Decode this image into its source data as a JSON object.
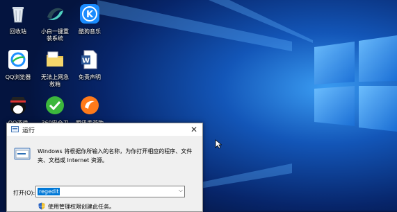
{
  "desktop": {
    "icons": [
      {
        "label": "回收站",
        "icon": "recycle-bin-icon"
      },
      {
        "label": "小白一键重装系统",
        "icon": "xiaobai-reinstall-icon"
      },
      {
        "label": "酷狗音乐",
        "icon": "kugou-music-icon"
      },
      {
        "label": "QQ浏览器",
        "icon": "qq-browser-icon"
      },
      {
        "label": "无法上网急救箱",
        "icon": "folder-icon"
      },
      {
        "label": "免责声明",
        "icon": "word-document-icon"
      },
      {
        "label": "QQ游戏",
        "icon": "qq-game-icon"
      },
      {
        "label": "360安全卫士",
        "icon": "360-safe-icon"
      },
      {
        "label": "腾讯手游助手",
        "icon": "tencent-mobile-game-icon"
      }
    ]
  },
  "run_dialog": {
    "title": "运行",
    "close_glyph": "✕",
    "description": "Windows 将根据你所输入的名称，为你打开相应的程序、文件夹、文档或 Internet 资源。",
    "open_label": "打开(O):",
    "open_value": "regedit",
    "dropdown_glyph": "⌵",
    "admin_text": "使用管理权限创建此任务。"
  },
  "colors": {
    "wallpaper_dark": "#061a4d",
    "wallpaper_light": "#2f8de4",
    "selection": "#0078d7"
  }
}
